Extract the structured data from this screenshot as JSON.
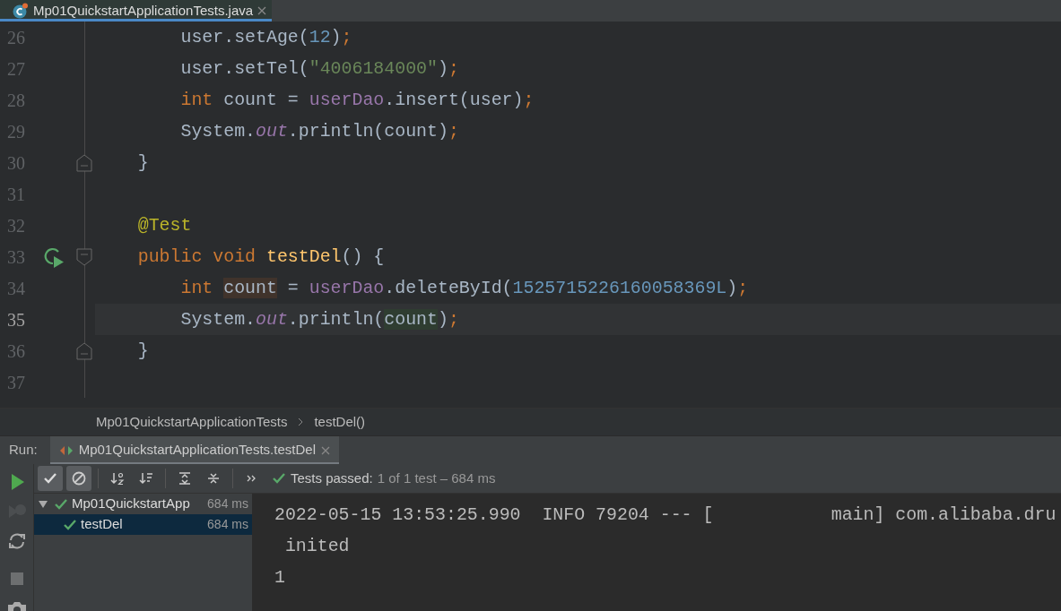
{
  "editor_tab": {
    "title": "Mp01QuickstartApplicationTests.java",
    "selected": true
  },
  "code_lines": [
    {
      "number": "26",
      "current": false,
      "run_marker": false,
      "fold_start": false,
      "fold_end": false,
      "tokens": [
        {
          "kind": "plain",
          "text": "        user.setAge("
        },
        {
          "kind": "number",
          "text": "12"
        },
        {
          "kind": "plain",
          "text": ")"
        },
        {
          "kind": "punct",
          "text": ";"
        }
      ]
    },
    {
      "number": "27",
      "current": false,
      "run_marker": false,
      "fold_start": false,
      "fold_end": false,
      "tokens": [
        {
          "kind": "plain",
          "text": "        user.setTel("
        },
        {
          "kind": "string",
          "text": "\"4006184000\""
        },
        {
          "kind": "plain",
          "text": ")"
        },
        {
          "kind": "punct",
          "text": ";"
        }
      ]
    },
    {
      "number": "28",
      "current": false,
      "run_marker": false,
      "fold_start": false,
      "fold_end": false,
      "tokens": [
        {
          "kind": "keyword",
          "text": "        int"
        },
        {
          "kind": "plain",
          "text": " count = "
        },
        {
          "kind": "field",
          "text": "userDao"
        },
        {
          "kind": "plain",
          "text": ".insert(user)"
        },
        {
          "kind": "punct",
          "text": ";"
        }
      ]
    },
    {
      "number": "29",
      "current": false,
      "run_marker": false,
      "fold_start": false,
      "fold_end": false,
      "tokens": [
        {
          "kind": "plain",
          "text": "        System."
        },
        {
          "kind": "static",
          "text": "out"
        },
        {
          "kind": "plain",
          "text": ".println(count)"
        },
        {
          "kind": "punct",
          "text": ";"
        }
      ]
    },
    {
      "number": "30",
      "current": false,
      "run_marker": false,
      "fold_start": false,
      "fold_end": true,
      "tokens": [
        {
          "kind": "plain",
          "text": "    }"
        }
      ]
    },
    {
      "number": "31",
      "current": false,
      "run_marker": false,
      "fold_start": false,
      "fold_end": false
    },
    {
      "number": "32",
      "current": false,
      "run_marker": false,
      "fold_start": false,
      "fold_end": false,
      "tokens": [
        {
          "kind": "annotation",
          "text": "    @Test"
        }
      ]
    },
    {
      "number": "33",
      "current": false,
      "run_marker": true,
      "fold_start": true,
      "fold_end": false,
      "tokens": [
        {
          "kind": "keyword",
          "text": "    public "
        },
        {
          "kind": "keyword",
          "text": "void "
        },
        {
          "kind": "method",
          "text": "testDel"
        },
        {
          "kind": "plain",
          "text": "() {"
        }
      ]
    },
    {
      "number": "34",
      "current": false,
      "run_marker": false,
      "fold_start": false,
      "fold_end": false,
      "tokens": [
        {
          "kind": "keyword",
          "text": "        int "
        },
        {
          "kind": "write",
          "text": "count"
        },
        {
          "kind": "plain",
          "text": " = "
        },
        {
          "kind": "field",
          "text": "userDao"
        },
        {
          "kind": "plain",
          "text": ".deleteById("
        },
        {
          "kind": "number",
          "text": "1525715226160058369L"
        },
        {
          "kind": "plain",
          "text": ")"
        },
        {
          "kind": "punct",
          "text": ";"
        }
      ]
    },
    {
      "number": "35",
      "current": true,
      "run_marker": false,
      "fold_start": false,
      "fold_end": false,
      "tokens": [
        {
          "kind": "plain",
          "text": "        System."
        },
        {
          "kind": "static",
          "text": "out"
        },
        {
          "kind": "plain",
          "text": ".println("
        },
        {
          "kind": "read",
          "text": "count"
        },
        {
          "kind": "plain",
          "text": ")"
        },
        {
          "kind": "punct",
          "text": ";"
        }
      ]
    },
    {
      "number": "36",
      "current": false,
      "run_marker": false,
      "fold_start": false,
      "fold_end": true,
      "tokens": [
        {
          "kind": "plain",
          "text": "    }"
        }
      ]
    },
    {
      "number": "37",
      "current": false,
      "run_marker": false,
      "fold_start": false,
      "fold_end": false
    }
  ],
  "breadcrumb": [
    "Mp01QuickstartApplicationTests",
    "testDel()"
  ],
  "run_panel": {
    "label": "Run:",
    "tab": {
      "title": "Mp01QuickstartApplicationTests.testDel",
      "selected": true
    }
  },
  "side_toolbar": [
    {
      "kind": "run",
      "disabled": false
    },
    {
      "kind": "rerun-failed",
      "disabled": true
    },
    {
      "kind": "toggle-auto-test",
      "disabled": false
    },
    {
      "kind": "stop",
      "disabled": true
    },
    {
      "kind": "screenshot",
      "disabled": false
    }
  ],
  "toolbar": [
    {
      "kind": "show-passed",
      "on": true
    },
    {
      "kind": "show-ignored",
      "on": true
    },
    {
      "kind": "sort-alpha",
      "on": false
    },
    {
      "kind": "sort-duration",
      "on": false
    },
    {
      "kind": "expand-all"
    },
    {
      "kind": "collapse-all"
    },
    {
      "kind": "more"
    }
  ],
  "status": {
    "passed": true,
    "label": "Tests passed:",
    "detail": "1 of 1 test – 684 ms"
  },
  "tests": [
    {
      "label": "Mp01QuickstartApp",
      "time": "684 ms",
      "passed": true,
      "expanded": true,
      "selected": false,
      "children": [
        {
          "label": "testDel",
          "time": "684 ms",
          "passed": true,
          "selected": true
        }
      ]
    }
  ],
  "console": [
    "2022-05-15 13:53:25.990  INFO 79204 --- [           main] com.alibaba.dru",
    " inited",
    "1"
  ]
}
